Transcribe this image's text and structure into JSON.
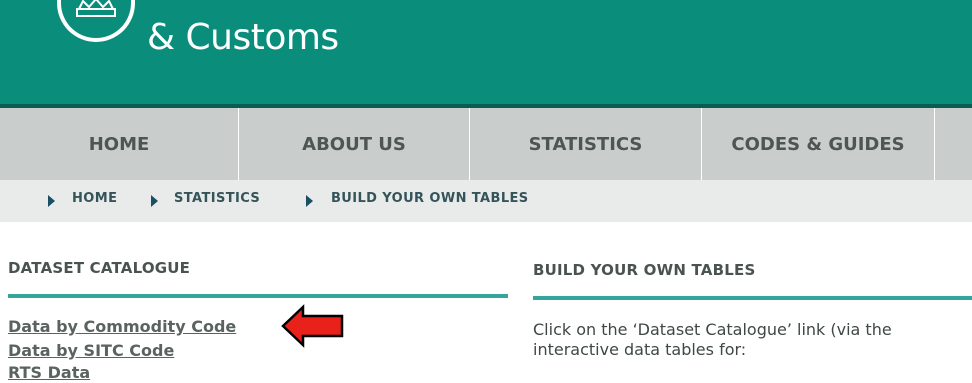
{
  "header": {
    "logo_text": "& Customs",
    "brand_color": "#0a8d7a"
  },
  "nav": {
    "items": [
      {
        "label": "HOME"
      },
      {
        "label": "ABOUT US"
      },
      {
        "label": "STATISTICS"
      },
      {
        "label": "CODES & GUIDES"
      }
    ]
  },
  "breadcrumb": {
    "items": [
      "HOME",
      "STATISTICS",
      "BUILD YOUR OWN TABLES"
    ]
  },
  "dataset_catalogue": {
    "title": "DATASET CATALOGUE",
    "links": [
      "Data by Commodity Code",
      "Data by SITC Code",
      "RTS Data"
    ]
  },
  "build_tables": {
    "title": "BUILD YOUR OWN TABLES",
    "text_line1": "Click on the ‘Dataset Catalogue’ link (via the",
    "text_line2": "interactive data tables for:"
  },
  "annotation": {
    "arrow_color": "#e8211b",
    "icon": "red-arrow-pointing-left"
  }
}
